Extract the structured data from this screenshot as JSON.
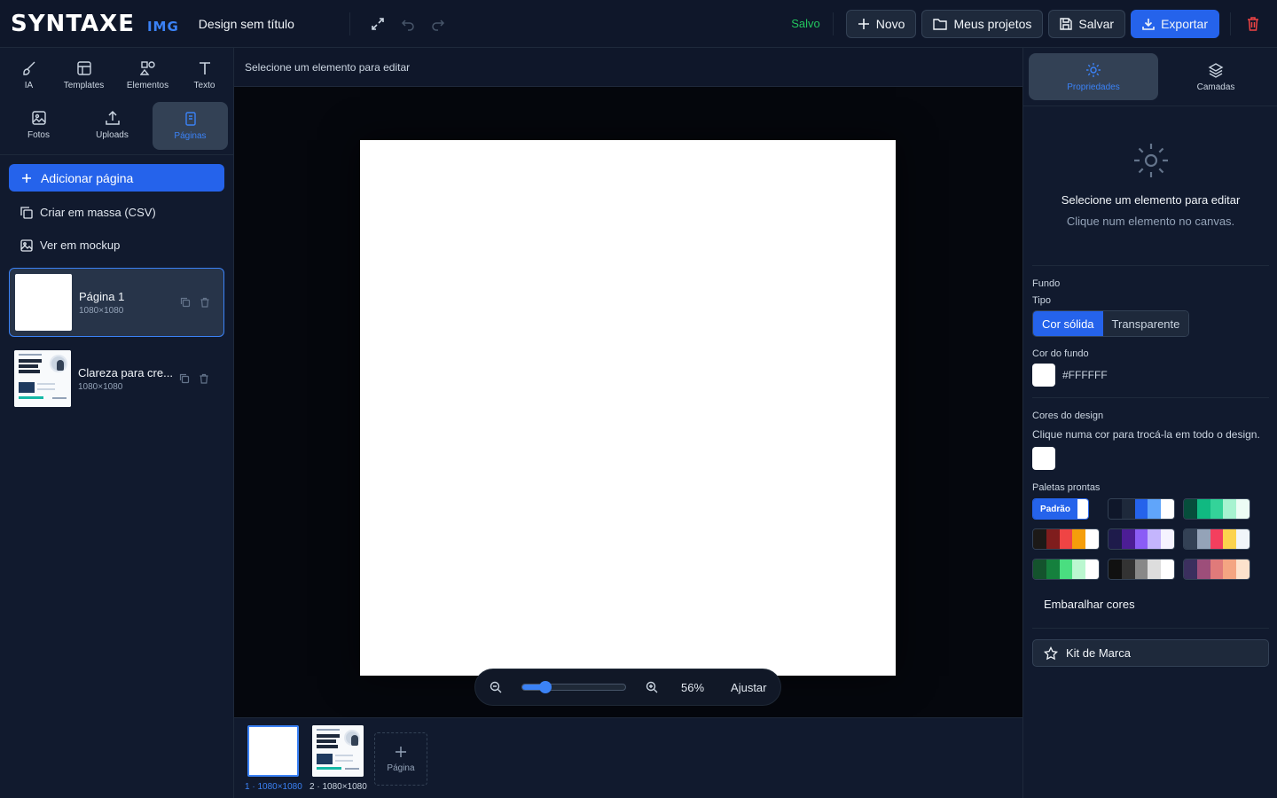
{
  "header": {
    "logo_main": "SYNTAXE",
    "logo_sub": "IMG",
    "doc_title": "Design sem título",
    "saved_status": "Salvo",
    "buttons": {
      "new": "Novo",
      "projects": "Meus projetos",
      "save": "Salvar",
      "export": "Exportar"
    }
  },
  "sidebar": {
    "tools": [
      {
        "label": "IA",
        "icon": "brush-icon"
      },
      {
        "label": "Templates",
        "icon": "layout-icon"
      },
      {
        "label": "Elementos",
        "icon": "shapes-icon"
      },
      {
        "label": "Texto",
        "icon": "text-icon"
      },
      {
        "label": "Fotos",
        "icon": "image-icon"
      },
      {
        "label": "Uploads",
        "icon": "upload-icon"
      },
      {
        "label": "Páginas",
        "icon": "pages-icon",
        "active": true
      }
    ],
    "add_page": "Adicionar página",
    "bulk_create": "Criar em massa (CSV)",
    "mockup": "Ver em mockup",
    "pages": [
      {
        "name": "Página 1",
        "size": "1080×1080",
        "active": true
      },
      {
        "name": "Clareza para cre...",
        "size": "1080×1080",
        "active": false
      }
    ]
  },
  "canvas": {
    "hint": "Selecione um elemento para editar",
    "background_color": "#FFFFFF",
    "zoom_percent": 56,
    "zoom_label": "56%",
    "fit_label": "Ajustar"
  },
  "filmstrip": {
    "items": [
      {
        "label": "1 · 1080×1080",
        "active": true
      },
      {
        "label": "2 · 1080×1080",
        "active": false
      }
    ],
    "add_label": "Página"
  },
  "properties": {
    "tabs": [
      {
        "label": "Propriedades",
        "icon": "sun-icon",
        "active": true
      },
      {
        "label": "Camadas",
        "icon": "layers-icon",
        "active": false
      }
    ],
    "empty_title": "Selecione um elemento para editar",
    "empty_subtitle": "Clique num elemento no canvas.",
    "background_section": "Fundo",
    "type_label": "Tipo",
    "type_options": [
      "Cor sólida",
      "Transparente"
    ],
    "type_selected": "Cor sólida",
    "bg_color_label": "Cor do fundo",
    "bg_color_value": "#FFFFFF",
    "design_colors_label": "Cores do design",
    "design_colors_hint": "Clique numa cor para trocá-la em todo o design.",
    "design_colors": [
      "#FFFFFF"
    ],
    "palettes_label": "Paletas prontas",
    "default_palette_badge": "Padrão",
    "palettes": [
      [
        "#ffffff"
      ],
      [
        "#0f172a",
        "#1e293b",
        "#2563eb",
        "#60a5fa",
        "#ffffff"
      ],
      [
        "#064e3b",
        "#10b981",
        "#34d399",
        "#a7f3d0",
        "#ecfdf5"
      ],
      [
        "#1c1917",
        "#7f1d1d",
        "#ef4444",
        "#f59e0b",
        "#ffffff"
      ],
      [
        "#1e1b4b",
        "#4c1d95",
        "#8b5cf6",
        "#c4b5fd",
        "#f5f3ff"
      ],
      [
        "#334155",
        "#94a3b8",
        "#f43f5e",
        "#fcd34d",
        "#f1f5f9"
      ],
      [
        "#14532d",
        "#15803d",
        "#4ade80",
        "#bbf7d0",
        "#ffffff"
      ],
      [
        "#111111",
        "#333333",
        "#888888",
        "#dddddd",
        "#ffffff"
      ],
      [
        "#3b2f5e",
        "#9d4e7a",
        "#e07a7a",
        "#f4a582",
        "#fde2cc"
      ]
    ],
    "shuffle_label": "Embaralhar cores",
    "brand_kit_label": "Kit de Marca"
  }
}
